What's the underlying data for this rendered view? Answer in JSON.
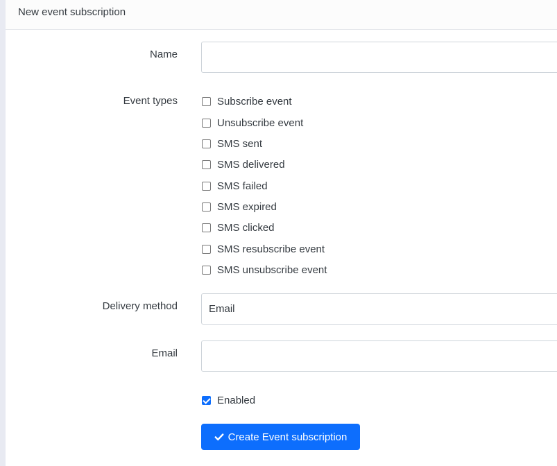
{
  "header": {
    "title": "New event subscription"
  },
  "form": {
    "name": {
      "label": "Name",
      "value": ""
    },
    "event_types": {
      "label": "Event types",
      "options": [
        {
          "label": "Subscribe event",
          "checked": false
        },
        {
          "label": "Unsubscribe event",
          "checked": false
        },
        {
          "label": "SMS sent",
          "checked": false
        },
        {
          "label": "SMS delivered",
          "checked": false
        },
        {
          "label": "SMS failed",
          "checked": false
        },
        {
          "label": "SMS expired",
          "checked": false
        },
        {
          "label": "SMS clicked",
          "checked": false
        },
        {
          "label": "SMS resubscribe event",
          "checked": false
        },
        {
          "label": "SMS unsubscribe event",
          "checked": false
        }
      ]
    },
    "delivery_method": {
      "label": "Delivery method",
      "value": "Email"
    },
    "email": {
      "label": "Email",
      "value": ""
    },
    "enabled": {
      "label": "Enabled",
      "checked": true
    },
    "submit": {
      "label": "Create Event subscription",
      "icon": "check-icon"
    }
  },
  "colors": {
    "primary": "#0d6efd",
    "page_background": "#e8eaf2"
  }
}
